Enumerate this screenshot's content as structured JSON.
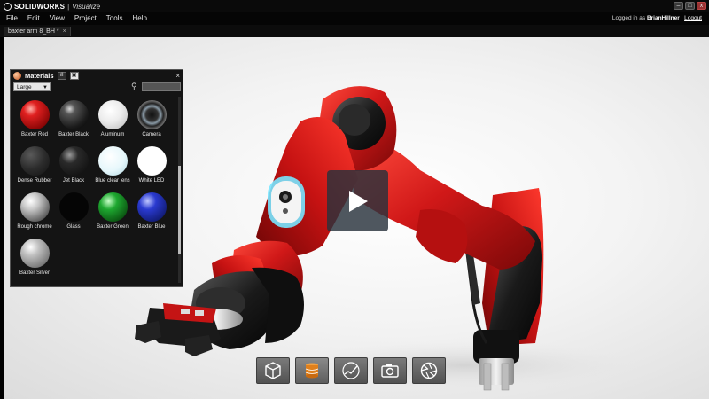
{
  "app": {
    "brand": "SOLIDWORKS",
    "separator": "|",
    "product": "Visualize"
  },
  "menu": [
    "File",
    "Edit",
    "View",
    "Project",
    "Tools",
    "Help"
  ],
  "login": {
    "prefix": "Logged in as",
    "user": "BrianHillner",
    "separator": "|",
    "logout": "Logout"
  },
  "tabs": [
    {
      "label": "baxter arm 8_BH *",
      "close": "×"
    }
  ],
  "materials": {
    "title": "Materials",
    "close": "×",
    "size_select": "Large",
    "items": [
      {
        "label": "Baxter Red",
        "style": "red"
      },
      {
        "label": "Baxter Black",
        "style": "black-gloss"
      },
      {
        "label": "Aluminum",
        "style": "aluminum"
      },
      {
        "label": "Camera",
        "style": "camera"
      },
      {
        "label": "Dense Rubber",
        "style": "rubber"
      },
      {
        "label": "Jet Black",
        "style": "jet-black"
      },
      {
        "label": "Blue clear lens",
        "style": "lens"
      },
      {
        "label": "White LED",
        "style": "white-led"
      },
      {
        "label": "Rough chrome",
        "style": "chrome"
      },
      {
        "label": "Glass",
        "style": "glass"
      },
      {
        "label": "Baxter Green",
        "style": "green"
      },
      {
        "label": "Baxter Blue",
        "style": "blue"
      },
      {
        "label": "Baxter Silver",
        "style": "silver"
      }
    ]
  },
  "toolbar": [
    {
      "name": "models",
      "icon": "cube-icon"
    },
    {
      "name": "appearances",
      "icon": "cylinder-stack-icon",
      "active": true
    },
    {
      "name": "scenes",
      "icon": "graph-curve-icon"
    },
    {
      "name": "cameras",
      "icon": "camera-icon"
    },
    {
      "name": "render",
      "icon": "aperture-icon"
    }
  ],
  "colors": {
    "baxter_red": "#c41414",
    "background": "#f0f0f0",
    "ui_dark": "#141414"
  }
}
